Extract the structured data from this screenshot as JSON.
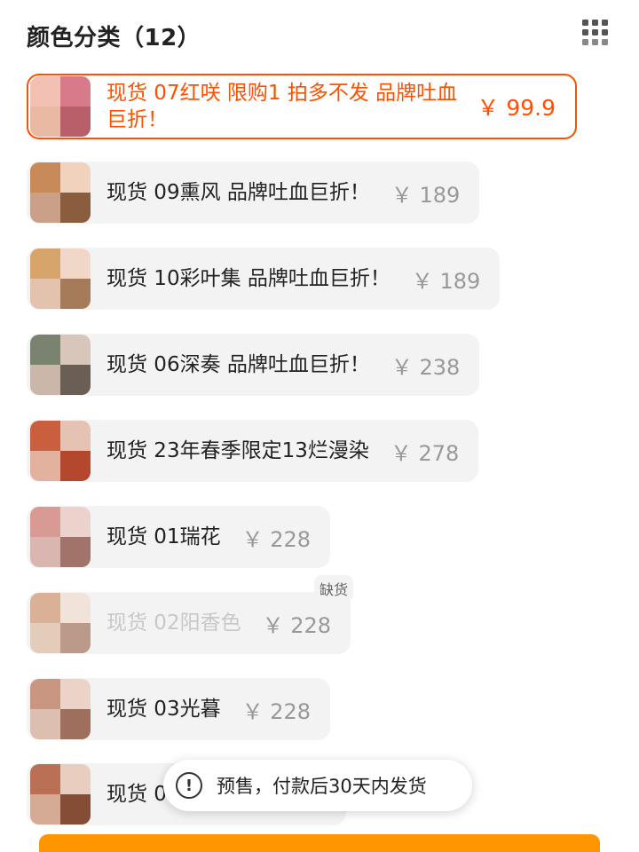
{
  "section": {
    "title": "颜色分类（12）"
  },
  "options": [
    {
      "label": "现货 07红咲  限购1 拍多不发 品牌吐血巨折！",
      "price": "￥ 99.9",
      "selected": true,
      "colors": [
        "#f2c1b3",
        "#d97a8a",
        "#e9b9a4",
        "#b85f6a"
      ]
    },
    {
      "label": "现货 09熏风 品牌吐血巨折！",
      "price": "￥ 189",
      "colors": [
        "#c98a5a",
        "#f0d2bd",
        "#caa188",
        "#8a5d3f"
      ]
    },
    {
      "label": "现货 10彩叶集 品牌吐血巨折！",
      "price": "￥ 189",
      "colors": [
        "#d7a46c",
        "#f1d7c7",
        "#e3c2ae",
        "#a67b5a"
      ]
    },
    {
      "label": "现货 06深奏 品牌吐血巨折！",
      "price": "￥ 238",
      "colors": [
        "#7a8270",
        "#d8c6bb",
        "#cbb6aa",
        "#6b5f55"
      ]
    },
    {
      "label": "现货 23年春季限定13烂漫染",
      "price": "￥ 278",
      "colors": [
        "#c95f3f",
        "#e6c2b2",
        "#e3b29e",
        "#b3482f"
      ]
    },
    {
      "label": "现货 01瑞花",
      "price": "￥ 228",
      "colors": [
        "#d89b93",
        "#ecd2cd",
        "#d9b6b0",
        "#a2736b"
      ]
    },
    {
      "label": "现货 02阳香色",
      "price": "￥ 228",
      "disabled": true,
      "colors": [
        "#c77b4d",
        "#f0d6c6",
        "#d9ad8f",
        "#8f5233"
      ]
    },
    {
      "label": "现货 03光暮",
      "price": "￥ 228",
      "colors": [
        "#c99682",
        "#ecd3c8",
        "#ddbfb1",
        "#9d6f5c"
      ]
    },
    {
      "label": "现货 0",
      "price": "",
      "colors": [
        "#b97055",
        "#e9cdbf",
        "#d6ab95",
        "#854c36"
      ]
    }
  ],
  "badges": {
    "out_of_stock": "缺货"
  },
  "toast": {
    "icon": "exclamation-icon",
    "glyph": "!",
    "text": "预售，付款后30天内发货"
  },
  "colors": {
    "accent": "#ff5000",
    "chip_bg": "#f3f3f3",
    "bottom_button": "#ff9500"
  }
}
